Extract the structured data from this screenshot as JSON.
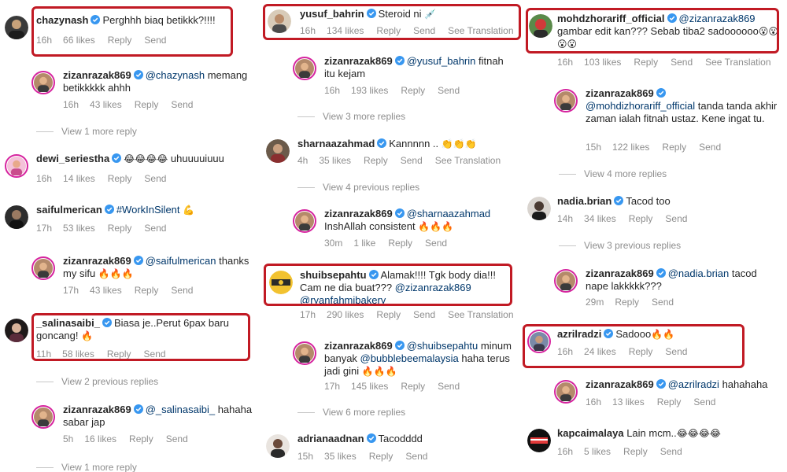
{
  "col1": {
    "c1": {
      "user": "chazynash",
      "text": "Perghhh biaq betikkk?!!!!",
      "time": "16h",
      "likes": "66 likes",
      "reply": "Reply",
      "send": "Send"
    },
    "r1": {
      "user": "zizanrazak869",
      "mention": "@chazynash",
      "text": " memang betikkkkk ahhh",
      "time": "16h",
      "likes": "43 likes",
      "reply": "Reply",
      "send": "Send"
    },
    "vm1": "View 1 more reply",
    "c2": {
      "user": "dewi_seriestha",
      "emoji": "😂😂😂😂",
      "text": " uhuuuuiuuu",
      "time": "16h",
      "likes": "14 likes",
      "reply": "Reply",
      "send": "Send"
    },
    "c3": {
      "user": "saifulmerican",
      "mention": "#WorkInSilent",
      "emoji": " 💪",
      "time": "17h",
      "likes": "53 likes",
      "reply": "Reply",
      "send": "Send"
    },
    "r3": {
      "user": "zizanrazak869",
      "mention": "@saifulmerican",
      "text": " thanks my sifu ",
      "emoji": "🔥🔥🔥",
      "time": "17h",
      "likes": "43 likes",
      "reply": "Reply",
      "send": "Send"
    },
    "c4": {
      "user": "_salinasaibi_",
      "text": "Biasa je..Perut 6pax baru goncang! ",
      "emoji": "🔥",
      "time": "11h",
      "likes": "58 likes",
      "reply": "Reply",
      "send": "Send"
    },
    "vm4": "View 2 previous replies",
    "r4": {
      "user": "zizanrazak869",
      "mention": "@_salinasaibi_",
      "text": " hahaha sabar jap",
      "time": "5h",
      "likes": "16 likes",
      "reply": "Reply",
      "send": "Send"
    },
    "vm5": "View 1 more reply"
  },
  "col2": {
    "c1": {
      "user": "yusuf_bahrin",
      "text": "Steroid ni ",
      "emoji": "💉",
      "time": "16h",
      "likes": "134 likes",
      "reply": "Reply",
      "send": "Send",
      "translate": "See Translation"
    },
    "r1": {
      "user": "zizanrazak869",
      "mention": "@yusuf_bahrin",
      "text": " fitnah itu kejam",
      "time": "16h",
      "likes": "193 likes",
      "reply": "Reply",
      "send": "Send"
    },
    "vm1": "View 3 more replies",
    "c2": {
      "user": "sharnaazahmad",
      "text": "Kannnnn .. ",
      "emoji": "👏👏👏",
      "time": "4h",
      "likes": "35 likes",
      "reply": "Reply",
      "send": "Send",
      "translate": "See Translation"
    },
    "vm2": "View 4 previous replies",
    "r2": {
      "user": "zizanrazak869",
      "mention": "@sharnaazahmad",
      "text": "InshAllah consistent ",
      "emoji": "🔥🔥🔥",
      "time": "30m",
      "likes": "1 like",
      "reply": "Reply",
      "send": "Send"
    },
    "c3": {
      "user": "shuibsepahtu",
      "text": "Alamak!!!! Tgk body dia!!! Cam ne dia buat??? ",
      "mention1": "@zizanrazak869",
      "mention2": "@ryanfahmibakery",
      "time": "17h",
      "likes": "290 likes",
      "reply": "Reply",
      "send": "Send",
      "translate": "See Translation"
    },
    "r3": {
      "user": "zizanrazak869",
      "mention": "@shuibsepahtu",
      "text1": " minum banyak ",
      "mention2": "@bubblebeemalaysia",
      "text2": " haha terus jadi gini ",
      "emoji": "🔥🔥🔥",
      "time": "17h",
      "likes": "145 likes",
      "reply": "Reply",
      "send": "Send"
    },
    "vm3": "View 6 more replies",
    "c4": {
      "user": "adrianaadnan",
      "text": "Tacodddd",
      "time": "15h",
      "likes": "35 likes",
      "reply": "Reply",
      "send": "Send"
    }
  },
  "col3": {
    "c1": {
      "user": "mohdzhorariff_official",
      "mention": "@zizanrazak869",
      "text": "gambar edit kan??? Sebab tiba2 sadoooooo",
      "emoji": "😮😮😮😮",
      "time": "16h",
      "likes": "103 likes",
      "reply": "Reply",
      "send": "Send",
      "translate": "See Translation"
    },
    "r1": {
      "user": "zizanrazak869",
      "mention": "@mohdizhorariff_official",
      "text": " tanda tanda akhir zaman ialah fitnah ustaz. Kene ingat tu.",
      "time": "15h",
      "likes": "122 likes",
      "reply": "Reply",
      "send": "Send"
    },
    "vm1": "View 4 more replies",
    "c2": {
      "user": "nadia.brian",
      "text": "Tacod too",
      "time": "14h",
      "likes": "34 likes",
      "reply": "Reply",
      "send": "Send"
    },
    "vm2": "View 3 previous replies",
    "r2": {
      "user": "zizanrazak869",
      "mention": "@nadia.brian",
      "text": " tacod nape lakkkkk???",
      "time": "29m",
      "likes": "Reply",
      "send": "Send"
    },
    "c3": {
      "user": "azrilradzi",
      "text": "Sadooo",
      "emoji": "🔥🔥",
      "time": "16h",
      "likes": "24 likes",
      "reply": "Reply",
      "send": "Send"
    },
    "r3": {
      "user": "zizanrazak869",
      "mention": "@azrilradzi",
      "text": " hahahaha",
      "time": "16h",
      "likes": "13 likes",
      "reply": "Reply",
      "send": "Send"
    },
    "c4": {
      "user": "kapcaimalaya",
      "text": "Lain mcm..",
      "emoji": "😂😂😂😂",
      "time": "16h",
      "likes": "5 likes",
      "reply": "Reply",
      "send": "Send"
    }
  },
  "colors": {
    "highlight": "#c11a24",
    "verified": "#3897f0",
    "mention": "#00376b",
    "meta": "#8e8e8e"
  }
}
